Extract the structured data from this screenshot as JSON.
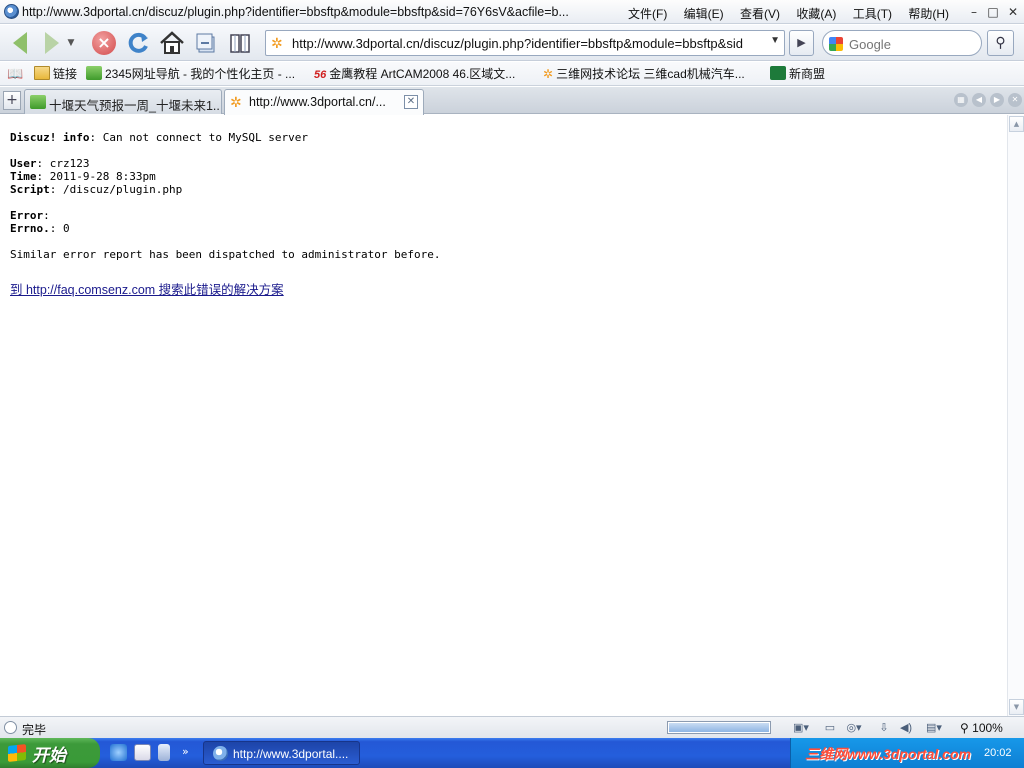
{
  "titlebar": {
    "title": "http://www.3dportal.cn/discuz/plugin.php?identifier=bbsftp&module=bbsftp&sid=76Y6sV&acfile=b...",
    "menu": [
      "文件(F)",
      "编辑(E)",
      "查看(V)",
      "收藏(A)",
      "工具(T)",
      "帮助(H)"
    ]
  },
  "navbar": {
    "address": "http://www.3dportal.cn/discuz/plugin.php?identifier=bbsftp&module=bbsftp&sid",
    "search_placeholder": "Google"
  },
  "favorites": [
    {
      "label": "链接",
      "icon": "folder-icon"
    },
    {
      "label": "2345网址导航 - 我的个性化主页 - ...",
      "icon": "site-2345-icon"
    },
    {
      "label": "金鹰教程 ArtCAM2008 46.区域文...",
      "icon": "site-56-icon",
      "badge": "56"
    },
    {
      "label": "三维网技术论坛 三维cad机械汽车...",
      "icon": "3dportal-favicon"
    },
    {
      "label": "新商盟",
      "icon": "xinshangmeng-icon"
    }
  ],
  "tabs": [
    {
      "label": "十堰天气预报一周_十堰未来1...",
      "active": false
    },
    {
      "label": "http://www.3dportal.cn/...",
      "active": true
    }
  ],
  "page": {
    "info_label": "Discuz! info",
    "info_text": ": Can not connect to MySQL server",
    "user_label": "User",
    "user_value": ": crz123",
    "time_label": "Time",
    "time_value": ": 2011-9-28 8:33pm",
    "script_label": "Script",
    "script_value": ": /discuz/plugin.php",
    "error_label": "Error",
    "error_value": ":",
    "errno_label": "Errno.",
    "errno_value": ": 0",
    "message": "Similar error report has been dispatched to administrator before.",
    "link_text": "到 http://faq.comsenz.com 搜索此错误的解决方案"
  },
  "statusbar": {
    "status": "完毕",
    "zoom": "100%",
    "progress": 1.0
  },
  "taskbar": {
    "start_label": "开始",
    "task_label": "http://www.3dportal....",
    "watermark": "三维网www.3dportal.com",
    "clock": "20:02"
  },
  "colors": {
    "link": "#1a1a8c",
    "taskbar": "#245edc",
    "start": "#3c9a3a",
    "watermark": "#ff4e3a"
  }
}
